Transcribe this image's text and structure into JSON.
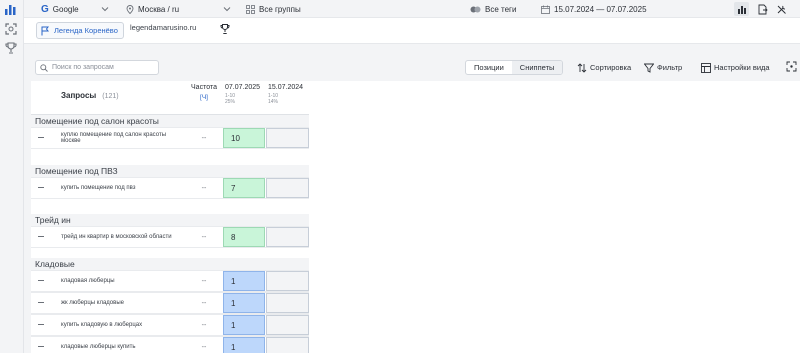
{
  "topbar": {
    "search_engine": "Google",
    "region": "Москва / ru",
    "groups": "Все группы",
    "tags": "Все теги",
    "date_range": "15.07.2024 — 07.07.2025"
  },
  "project": {
    "name": "Легенда Коренёво",
    "domain": "legendamarusino.ru"
  },
  "toolbar": {
    "search_placeholder": "Поиск по запросам",
    "tabs": [
      {
        "label": "Позиции",
        "active": false
      },
      {
        "label": "Сниппеты",
        "active": true
      }
    ],
    "sort_label": "Сортировка",
    "filter_label": "Фильтр",
    "view_settings_label": "Настройки вида"
  },
  "table": {
    "queries_header": "Запросы",
    "queries_count": "(121)",
    "frequency_header": "Частота",
    "frequency_sub": "[Ч]",
    "dates": [
      {
        "date": "07.07.2025",
        "line1": "1-10",
        "line2": "25%"
      },
      {
        "date": "15.07.2024",
        "line1": "1-10",
        "line2": "14%"
      }
    ],
    "groups": [
      {
        "name": "Помещение под салон красоты",
        "rows": [
          {
            "query": "куплю помещение под салон красоты москве",
            "freq": "--",
            "pos1": "10",
            "color": "green"
          }
        ]
      },
      {
        "name": "Помещение под ПВЗ",
        "rows": [
          {
            "query": "купить помещение под пвз",
            "freq": "--",
            "pos1": "7",
            "color": "green"
          }
        ]
      },
      {
        "name": "Трейд ин",
        "rows": [
          {
            "query": "трейд ин квартир в московской области",
            "freq": "--",
            "pos1": "8",
            "color": "green"
          }
        ]
      },
      {
        "name": "Кладовые",
        "rows": [
          {
            "query": "кладовая люберцы",
            "freq": "--",
            "pos1": "1",
            "color": "blue"
          },
          {
            "query": "жк люберцы кладовые",
            "freq": "--",
            "pos1": "1",
            "color": "blue"
          },
          {
            "query": "купить кладовую в люберцах",
            "freq": "--",
            "pos1": "1",
            "color": "blue"
          },
          {
            "query": "кладовые люберцы купить",
            "freq": "--",
            "pos1": "1",
            "color": "blue"
          }
        ]
      }
    ]
  },
  "colors": {
    "accent": "#2a65c7",
    "cell_green": "#c9f5d9",
    "cell_blue": "#bdd7fb"
  }
}
